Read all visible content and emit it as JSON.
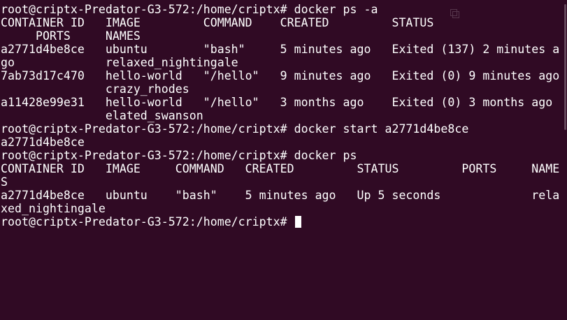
{
  "terminal": {
    "lines": [
      "root@criptx-Predator-G3-572:/home/criptx# docker ps -a",
      "CONTAINER ID   IMAGE         COMMAND    CREATED         STATUS",
      "     PORTS     NAMES",
      "a2771d4be8ce   ubuntu        \"bash\"     5 minutes ago   Exited (137) 2 minutes a",
      "go             relaxed_nightingale",
      "7ab73d17c470   hello-world   \"/hello\"   9 minutes ago   Exited (0) 9 minutes ago",
      "               crazy_rhodes",
      "a11428e99e31   hello-world   \"/hello\"   3 months ago    Exited (0) 3 months ago",
      "               elated_swanson",
      "root@criptx-Predator-G3-572:/home/criptx# docker start a2771d4be8ce",
      "a2771d4be8ce",
      "root@criptx-Predator-G3-572:/home/criptx# docker ps",
      "CONTAINER ID   IMAGE     COMMAND   CREATED         STATUS         PORTS     NAME",
      "S",
      "a2771d4be8ce   ubuntu    \"bash\"    5 minutes ago   Up 5 seconds             rela",
      "xed_nightingale"
    ],
    "prompt": "root@criptx-Predator-G3-572:/home/criptx# "
  },
  "colors": {
    "background": "#300a24",
    "foreground": "#ffffff"
  },
  "icons": {
    "watermark": "copy-icon"
  }
}
